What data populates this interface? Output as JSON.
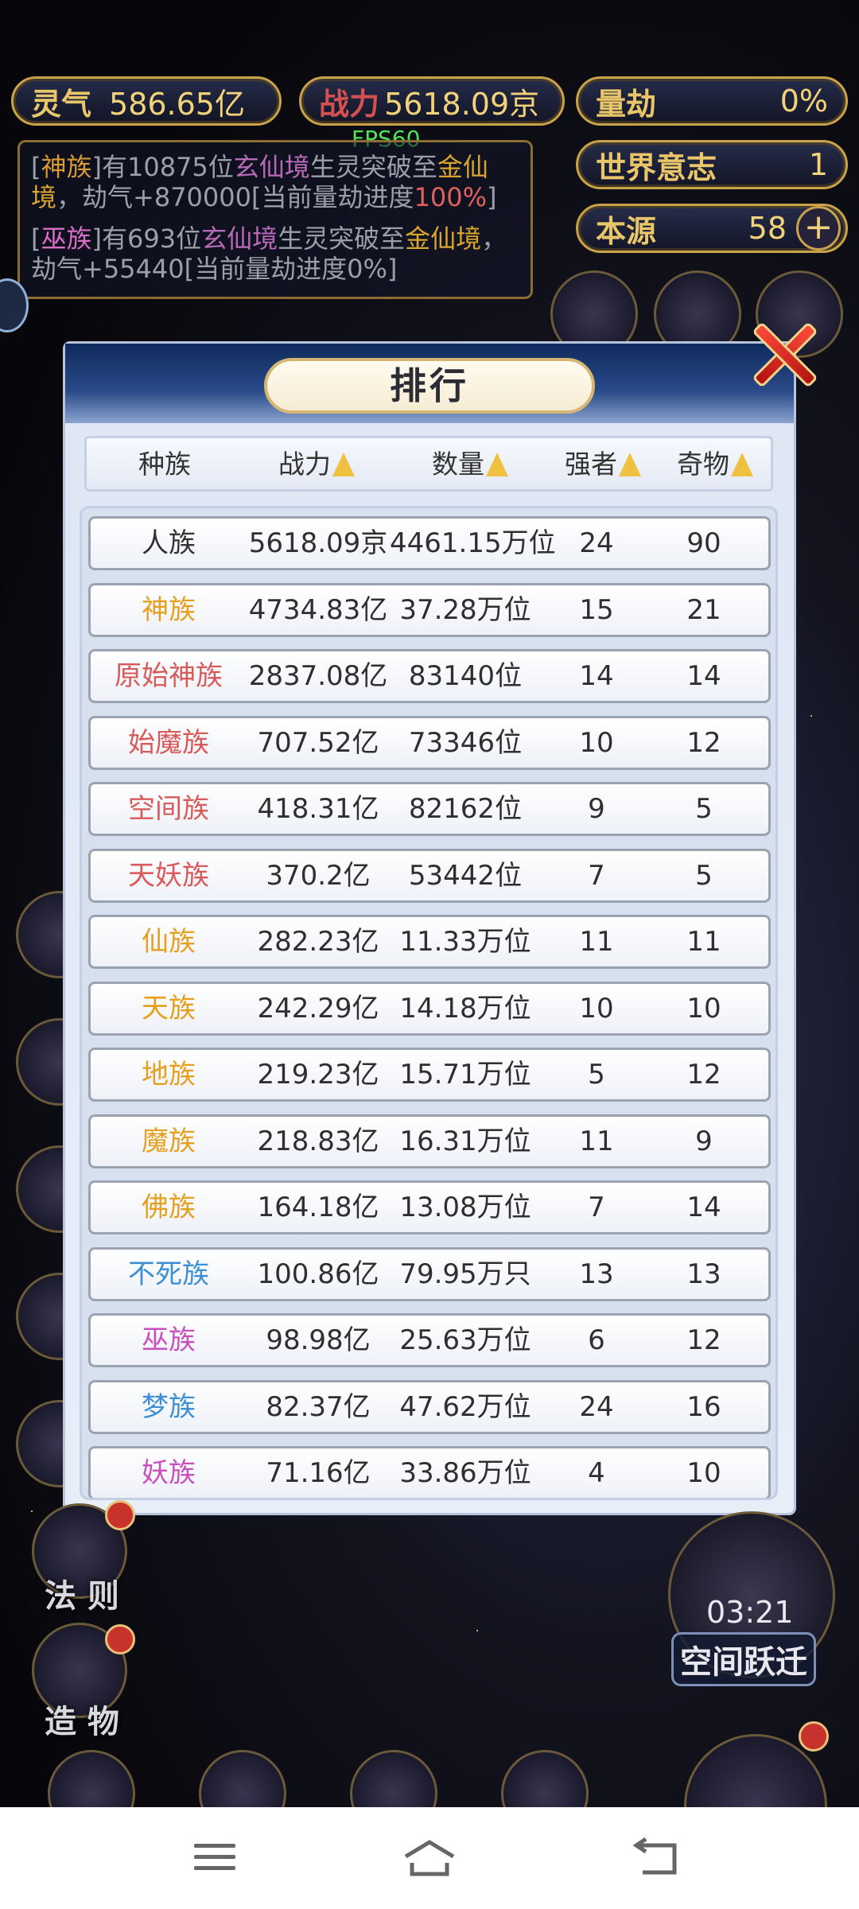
{
  "hud": {
    "lingqi_label": "灵气",
    "lingqi_value": "586.65亿",
    "zhanli_label": "战力",
    "zhanli_value": "5618.09京",
    "liangjie_label": "量劫",
    "liangjie_value": "0%",
    "shijie_label": "世界意志",
    "shijie_value": "1",
    "benyuan_label": "本源",
    "benyuan_value": "58",
    "plus": "+",
    "fps": "FPS60"
  },
  "log": [
    {
      "p1": "[",
      "race": "神族",
      "p2": "]有10875位",
      "xian": "玄仙境",
      "p3": "生灵突破至",
      "jin": "金仙境",
      "p4": "，劫气+870000[当前量劫进度",
      "pct": "100%",
      "p5": "]"
    },
    {
      "p1": "[",
      "race": "巫族",
      "p2": "]有693位",
      "xian": "玄仙境",
      "p3": "生灵突破至",
      "jin": "金仙境",
      "p4": "，劫气+55440[当前量劫进度0%]"
    }
  ],
  "panel": {
    "title": "排行",
    "headers": {
      "race": "种族",
      "power": "战力",
      "count": "数量",
      "strong": "强者",
      "treasure": "奇物"
    },
    "rows": [
      {
        "race": "人族",
        "color": "#333333",
        "power": "5618.09京",
        "count": "4461.15万位",
        "strong": "24",
        "treasure": "90"
      },
      {
        "race": "神族",
        "color": "#e6a020",
        "power": "4734.83亿",
        "count": "37.28万位",
        "strong": "15",
        "treasure": "21"
      },
      {
        "race": "原始神族",
        "color": "#d85a5a",
        "power": "2837.08亿",
        "count": "83140位",
        "strong": "14",
        "treasure": "14"
      },
      {
        "race": "始魔族",
        "color": "#d85a5a",
        "power": "707.52亿",
        "count": "73346位",
        "strong": "10",
        "treasure": "12"
      },
      {
        "race": "空间族",
        "color": "#d85a5a",
        "power": "418.31亿",
        "count": "82162位",
        "strong": "9",
        "treasure": "5"
      },
      {
        "race": "天妖族",
        "color": "#d85a5a",
        "power": "370.2亿",
        "count": "53442位",
        "strong": "7",
        "treasure": "5"
      },
      {
        "race": "仙族",
        "color": "#e6a020",
        "power": "282.23亿",
        "count": "11.33万位",
        "strong": "11",
        "treasure": "11"
      },
      {
        "race": "天族",
        "color": "#e6a020",
        "power": "242.29亿",
        "count": "14.18万位",
        "strong": "10",
        "treasure": "10"
      },
      {
        "race": "地族",
        "color": "#e6a020",
        "power": "219.23亿",
        "count": "15.71万位",
        "strong": "5",
        "treasure": "12"
      },
      {
        "race": "魔族",
        "color": "#e6a020",
        "power": "218.83亿",
        "count": "16.31万位",
        "strong": "11",
        "treasure": "9"
      },
      {
        "race": "佛族",
        "color": "#e6a020",
        "power": "164.18亿",
        "count": "13.08万位",
        "strong": "7",
        "treasure": "14"
      },
      {
        "race": "不死族",
        "color": "#3c8fd4",
        "power": "100.86亿",
        "count": "79.95万只",
        "strong": "13",
        "treasure": "13"
      },
      {
        "race": "巫族",
        "color": "#c94fc0",
        "power": "98.98亿",
        "count": "25.63万位",
        "strong": "6",
        "treasure": "12"
      },
      {
        "race": "梦族",
        "color": "#3c8fd4",
        "power": "82.37亿",
        "count": "47.62万位",
        "strong": "24",
        "treasure": "16"
      },
      {
        "race": "妖族",
        "color": "#c94fc0",
        "power": "71.16亿",
        "count": "33.86万位",
        "strong": "4",
        "treasure": "10"
      }
    ]
  },
  "bottom": {
    "fa_ze": "法 则",
    "zao_wu": "造 物",
    "space_timer": "03:21",
    "space_label": "空间跃迁"
  }
}
